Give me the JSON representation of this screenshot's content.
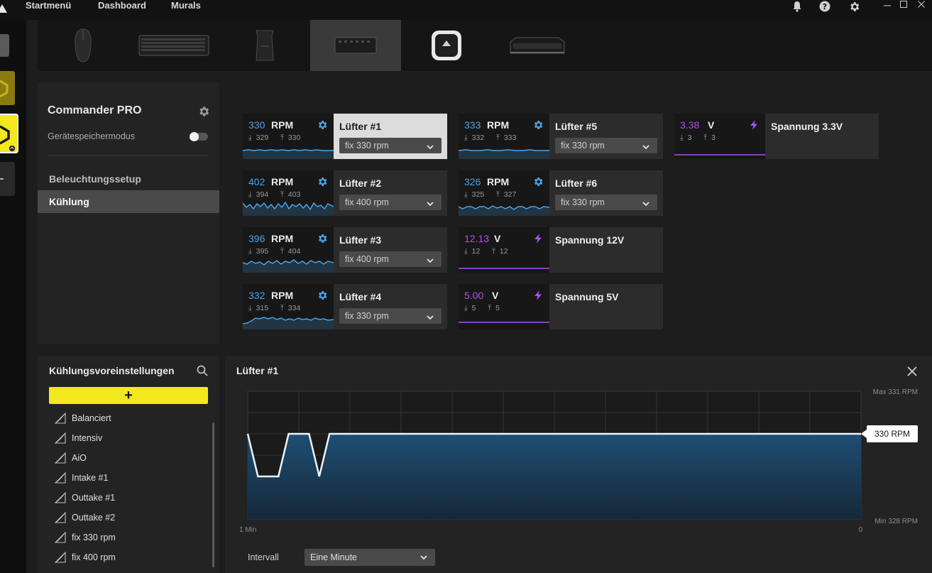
{
  "nav": {
    "startmenu": "Startmenü",
    "dashboard": "Dashboard",
    "murals": "Murals"
  },
  "icons": {
    "bell": "bell-icon",
    "help": "help-icon",
    "settings": "gear-icon",
    "minimize": "minimize-icon",
    "maximize": "maximize-icon",
    "close": "close-icon"
  },
  "colors": {
    "rpm": "#4aa3e8",
    "volt": "#b04ef0",
    "accent_yellow": "#f3e71f"
  },
  "devices": [
    "mouse",
    "keyboard",
    "headset-stand",
    "commander-pro",
    "cooler",
    "memory"
  ],
  "device_panel": {
    "title": "Commander PRO",
    "storage_mode_label": "Gerätespeichermodus",
    "menu": [
      {
        "label": "Beleuchtungssetup",
        "active": false
      },
      {
        "label": "Kühlung",
        "active": true
      }
    ]
  },
  "sensors": [
    {
      "id": "fan1",
      "value": "330",
      "unit": "RPM",
      "min": "329",
      "max": "330",
      "name": "Lüfter #1",
      "mode": "fix 330 rpm",
      "type": "fan",
      "selected": true
    },
    {
      "id": "fan2",
      "value": "402",
      "unit": "RPM",
      "min": "394",
      "max": "403",
      "name": "Lüfter #2",
      "mode": "fix 400 rpm",
      "type": "fan"
    },
    {
      "id": "fan3",
      "value": "396",
      "unit": "RPM",
      "min": "395",
      "max": "404",
      "name": "Lüfter #3",
      "mode": "fix 400 rpm",
      "type": "fan"
    },
    {
      "id": "fan4",
      "value": "332",
      "unit": "RPM",
      "min": "315",
      "max": "334",
      "name": "Lüfter #4",
      "mode": "fix 330 rpm",
      "type": "fan"
    },
    {
      "id": "fan5",
      "value": "333",
      "unit": "RPM",
      "min": "332",
      "max": "333",
      "name": "Lüfter #5",
      "mode": "fix 330 rpm",
      "type": "fan"
    },
    {
      "id": "fan6",
      "value": "326",
      "unit": "RPM",
      "min": "325",
      "max": "327",
      "name": "Lüfter #6",
      "mode": "fix 330 rpm",
      "type": "fan"
    },
    {
      "id": "v12",
      "value": "12.13",
      "unit": "V",
      "min": "12",
      "max": "12",
      "name": "Spannung 12V",
      "type": "volt"
    },
    {
      "id": "v5",
      "value": "5.00",
      "unit": "V",
      "min": "5",
      "max": "5",
      "name": "Spannung 5V",
      "type": "volt"
    },
    {
      "id": "v33",
      "value": "3.38",
      "unit": "V",
      "min": "3",
      "max": "3",
      "name": "Spannung 3.3V",
      "type": "volt"
    }
  ],
  "presets": {
    "title": "Kühlungsvoreinstellungen",
    "add_label": "+",
    "items": [
      "Balanciert",
      "Intensiv",
      "AiO",
      "Intake #1",
      "Outtake #1",
      "Outtake #2",
      "fix 330 rpm",
      "fix 400 rpm"
    ]
  },
  "detail": {
    "title": "Lüfter #1",
    "interval_label": "Intervall",
    "interval_value": "Eine Minute",
    "max_label": "Max 331 RPM",
    "min_label": "Min 328 RPM",
    "current_label": "330 RPM",
    "x_start_label": "1 Min",
    "x_end_label": "0"
  },
  "chart_data": {
    "type": "area",
    "title": "Lüfter #1",
    "xlabel": "",
    "ylabel": "",
    "xlim": [
      60,
      0
    ],
    "ylim": [
      328,
      331
    ],
    "x_ticks": [
      "1 Min",
      "0"
    ],
    "grid": true,
    "series": [
      {
        "values": [
          {
            "x": 60,
            "y": 330
          },
          {
            "x": 59,
            "y": 329
          },
          {
            "x": 57,
            "y": 329
          },
          {
            "x": 56,
            "y": 330
          },
          {
            "x": 54,
            "y": 330
          },
          {
            "x": 53,
            "y": 329
          },
          {
            "x": 52,
            "y": 330
          },
          {
            "x": 0,
            "y": 330
          }
        ]
      }
    ]
  }
}
